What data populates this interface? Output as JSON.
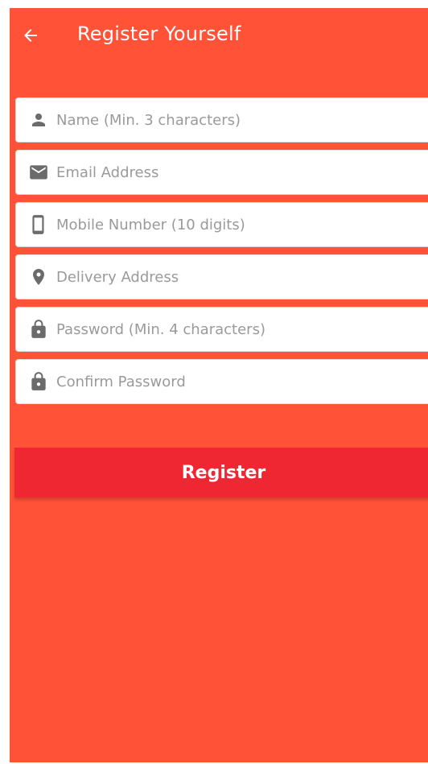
{
  "colors": {
    "background": "#ff5237",
    "button": "#ef2733",
    "icon": "#6b6b6b",
    "placeholder": "#9a9a9a"
  },
  "header": {
    "title": "Register Yourself",
    "back_icon": "arrow-left-icon"
  },
  "form": {
    "fields": [
      {
        "icon": "person-icon",
        "placeholder": "Name (Min. 3 characters)",
        "value": ""
      },
      {
        "icon": "mail-icon",
        "placeholder": "Email Address",
        "value": ""
      },
      {
        "icon": "phone-icon",
        "placeholder": "Mobile Number (10 digits)",
        "value": ""
      },
      {
        "icon": "location-pin-icon",
        "placeholder": "Delivery Address",
        "value": ""
      },
      {
        "icon": "lock-icon",
        "placeholder": "Password (Min. 4 characters)",
        "value": ""
      },
      {
        "icon": "lock-icon",
        "placeholder": "Confirm Password",
        "value": ""
      }
    ],
    "submit_label": "Register"
  }
}
